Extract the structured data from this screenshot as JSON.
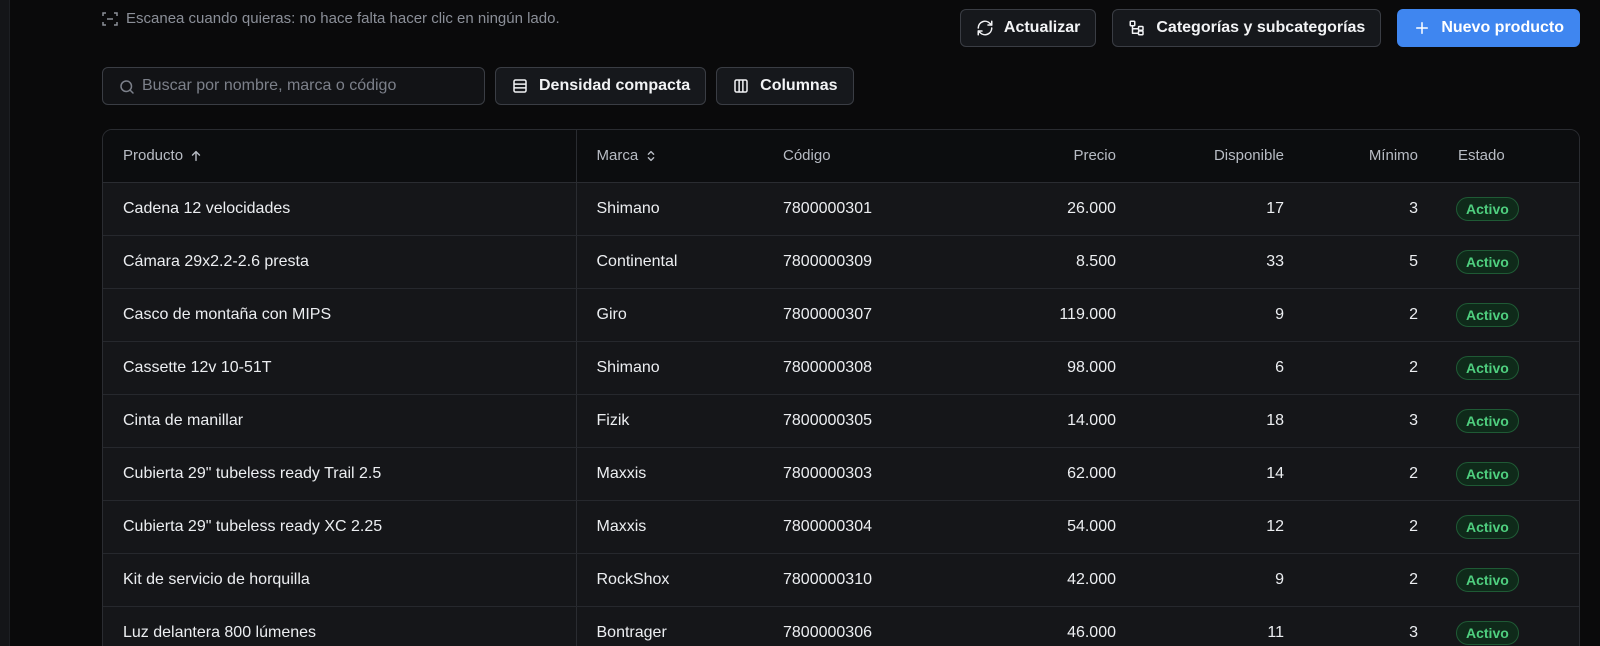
{
  "scan_hint": "Escanea cuando quieras: no hace falta hacer clic en ningún lado.",
  "actions": {
    "refresh": "Actualizar",
    "categories": "Categorías y subcategorías",
    "new_product": "Nuevo producto"
  },
  "toolbar": {
    "search_placeholder": "Buscar por nombre, marca o código",
    "density": "Densidad compacta",
    "columns": "Columnas"
  },
  "table": {
    "headers": {
      "product": "Producto",
      "brand": "Marca",
      "code": "Código",
      "price": "Precio",
      "available": "Disponible",
      "minimum": "Mínimo",
      "status": "Estado"
    },
    "rows": [
      {
        "product": "Cadena 12 velocidades",
        "brand": "Shimano",
        "code": "7800000301",
        "price": "26.000",
        "available": "17",
        "minimum": "3",
        "status": "Activo"
      },
      {
        "product": "Cámara 29x2.2-2.6 presta",
        "brand": "Continental",
        "code": "7800000309",
        "price": "8.500",
        "available": "33",
        "minimum": "5",
        "status": "Activo"
      },
      {
        "product": "Casco de montaña con MIPS",
        "brand": "Giro",
        "code": "7800000307",
        "price": "119.000",
        "available": "9",
        "minimum": "2",
        "status": "Activo"
      },
      {
        "product": "Cassette 12v 10-51T",
        "brand": "Shimano",
        "code": "7800000308",
        "price": "98.000",
        "available": "6",
        "minimum": "2",
        "status": "Activo"
      },
      {
        "product": "Cinta de manillar",
        "brand": "Fizik",
        "code": "7800000305",
        "price": "14.000",
        "available": "18",
        "minimum": "3",
        "status": "Activo"
      },
      {
        "product": "Cubierta 29\" tubeless ready Trail 2.5",
        "brand": "Maxxis",
        "code": "7800000303",
        "price": "62.000",
        "available": "14",
        "minimum": "2",
        "status": "Activo"
      },
      {
        "product": "Cubierta 29\" tubeless ready XC 2.25",
        "brand": "Maxxis",
        "code": "7800000304",
        "price": "54.000",
        "available": "12",
        "minimum": "2",
        "status": "Activo"
      },
      {
        "product": "Kit de servicio de horquilla",
        "brand": "RockShox",
        "code": "7800000310",
        "price": "42.000",
        "available": "9",
        "minimum": "2",
        "status": "Activo"
      },
      {
        "product": "Luz delantera 800 lúmenes",
        "brand": "Bontrager",
        "code": "7800000306",
        "price": "46.000",
        "available": "11",
        "minimum": "3",
        "status": "Activo"
      }
    ]
  },
  "icons": {
    "scan": "scan-icon",
    "refresh": "refresh-icon",
    "categories": "category-tree-icon",
    "new": "plus-icon",
    "search": "search-icon",
    "density": "rows-icon",
    "columns": "columns-icon",
    "sort_asc": "arrow-up-icon",
    "sort_both": "chevron-up-down-icon"
  },
  "colors": {
    "primary": "#3f86f0",
    "status_active": "#4fcf7f",
    "background": "#0a0a0b"
  }
}
